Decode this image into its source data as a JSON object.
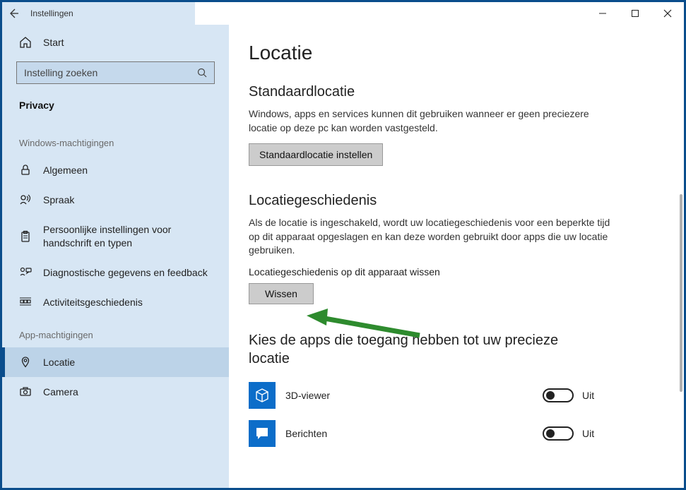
{
  "window": {
    "title": "Instellingen"
  },
  "sidebar": {
    "home": "Start",
    "searchPlaceholder": "Instelling zoeken",
    "category": "Privacy",
    "groups": {
      "windows": "Windows-machtigingen",
      "app": "App-machtigingen"
    },
    "items": {
      "algemeen": "Algemeen",
      "spraak": "Spraak",
      "handschrift": "Persoonlijke instellingen voor handschrift en typen",
      "diagnost": "Diagnostische gegevens en feedback",
      "activiteit": "Activiteitsgeschiedenis",
      "locatie": "Locatie",
      "camera": "Camera"
    }
  },
  "main": {
    "title": "Locatie",
    "defaultLoc": {
      "heading": "Standaardlocatie",
      "desc": "Windows, apps en services kunnen dit gebruiken wanneer er geen preciezere locatie op deze pc kan worden vastgesteld.",
      "button": "Standaardlocatie instellen"
    },
    "history": {
      "heading": "Locatiegeschiedenis",
      "desc": "Als de locatie is ingeschakeld, wordt uw locatiegeschiedenis voor een beperkte tijd op dit apparaat opgeslagen en kan deze worden gebruikt door apps die uw locatie gebruiken.",
      "clearLabel": "Locatiegeschiedenis op dit apparaat wissen",
      "clearButton": "Wissen"
    },
    "apps": {
      "heading": "Kies de apps die toegang hebben tot uw precieze locatie",
      "rows": [
        {
          "name": "3D-viewer",
          "state": "Uit"
        },
        {
          "name": "Berichten",
          "state": "Uit"
        }
      ]
    }
  }
}
